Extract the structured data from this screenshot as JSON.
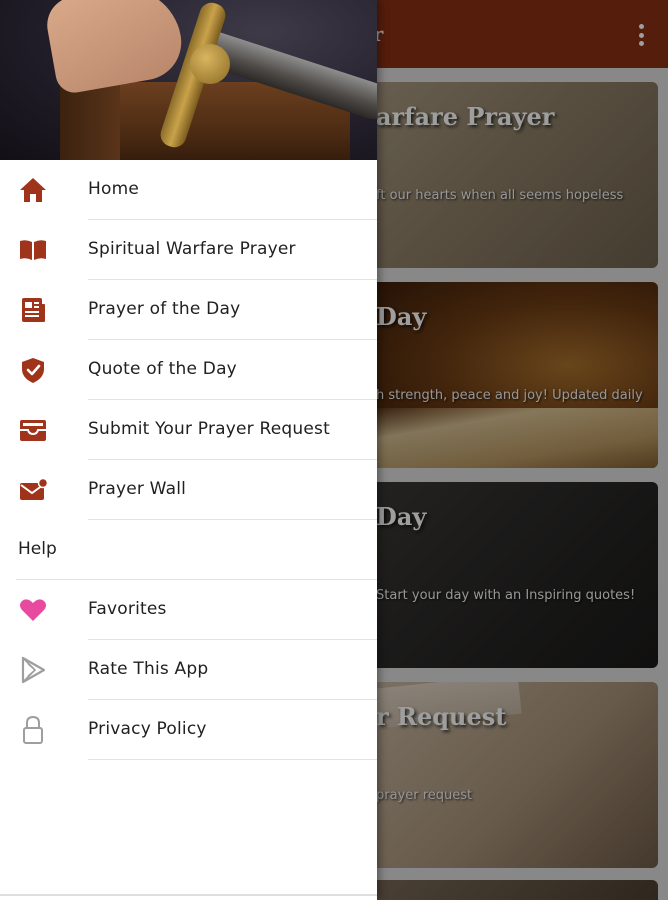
{
  "appbar": {
    "title_fragment": "er",
    "overflow_icon": "more-vert-icon",
    "color": "#8a2f14"
  },
  "cards": [
    {
      "title": "arfare Prayer",
      "subtitle": "ft our hearts when all seems hopeless"
    },
    {
      "title": "Day",
      "subtitle": "h strength, peace and joy! Updated daily"
    },
    {
      "title": "Day",
      "subtitle": "Start your day with an Inspiring quotes!"
    },
    {
      "title": "r Request",
      "subtitle": "prayer request"
    }
  ],
  "drawer": {
    "accent_color": "#a0341b",
    "items": [
      {
        "label": "Home",
        "icon": "home-icon"
      },
      {
        "label": "Spiritual Warfare Prayer",
        "icon": "open-book-icon"
      },
      {
        "label": "Prayer of the Day",
        "icon": "newspaper-icon"
      },
      {
        "label": "Quote of the Day",
        "icon": "shield-check-icon"
      },
      {
        "label": "Submit Your Prayer Request",
        "icon": "inbox-tray-icon"
      },
      {
        "label": "Prayer Wall",
        "icon": "mail-notification-icon"
      }
    ],
    "section": {
      "label": "Help"
    },
    "help_items": [
      {
        "label": "Favorites",
        "icon": "heart-icon",
        "color": "#e84aa0"
      },
      {
        "label": "Rate This App",
        "icon": "play-store-icon",
        "color": "#9e9e9e"
      },
      {
        "label": "Privacy Policy",
        "icon": "lock-icon",
        "color": "#9e9e9e"
      }
    ]
  }
}
